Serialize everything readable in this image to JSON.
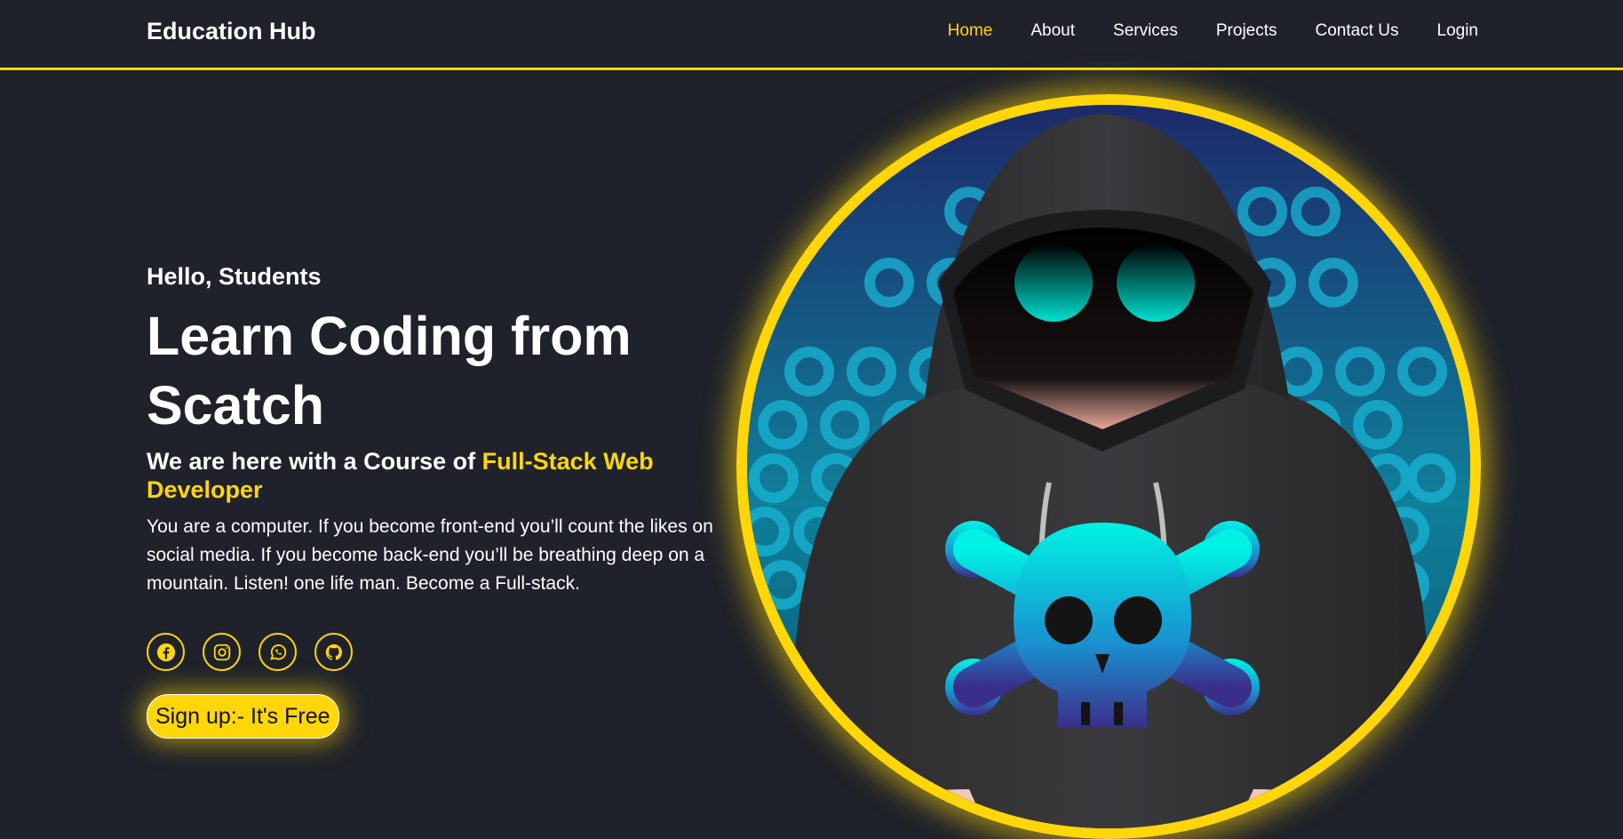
{
  "header": {
    "logo": "Education Hub",
    "nav": [
      {
        "label": "Home",
        "active": true
      },
      {
        "label": "About",
        "active": false
      },
      {
        "label": "Services",
        "active": false
      },
      {
        "label": "Projects",
        "active": false
      },
      {
        "label": "Contact Us",
        "active": false
      },
      {
        "label": "Login",
        "active": false
      }
    ]
  },
  "hero": {
    "greeting": "Hello, Students",
    "headline": "Learn Coding from Scatch",
    "subhead_prefix": "We are here with a Course of ",
    "subhead_accent": "Full-Stack Web Developer",
    "description": "You are a computer. If you become front-end you’ll count the likes on social media. If you become back-end you’ll be breathing deep on a mountain. Listen! one life man. Become a Full-stack.",
    "signup_label": "Sign up:- It's Free"
  },
  "socials": [
    {
      "icon": "facebook-icon"
    },
    {
      "icon": "instagram-icon"
    },
    {
      "icon": "whatsapp-icon"
    },
    {
      "icon": "github-icon"
    }
  ],
  "colors": {
    "background": "#1f222a",
    "accent": "#ffd60a",
    "text": "#ffffff",
    "skull": "#00e5e0"
  }
}
